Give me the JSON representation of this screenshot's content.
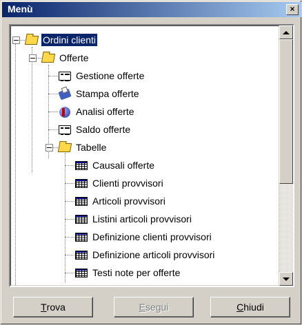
{
  "window": {
    "title": "Menù",
    "close_symbol": "×"
  },
  "tree": {
    "nodes": [
      {
        "label": "Ordini clienti",
        "icon": "folder-open-icon",
        "level": 0,
        "expanded": true,
        "selected": true
      },
      {
        "label": "Offerte",
        "icon": "folder-open-icon",
        "level": 1,
        "expanded": true
      },
      {
        "label": "Gestione offerte",
        "icon": "form-icon",
        "level": 2
      },
      {
        "label": "Stampa offerte",
        "icon": "print-icon",
        "level": 2
      },
      {
        "label": "Analisi offerte",
        "icon": "analysis-icon",
        "level": 2
      },
      {
        "label": "Saldo offerte",
        "icon": "form-icon",
        "level": 2
      },
      {
        "label": "Tabelle",
        "icon": "folder-open-icon",
        "level": 2,
        "expanded": true
      },
      {
        "label": "Causali offerte",
        "icon": "table-icon",
        "level": 3
      },
      {
        "label": "Clienti provvisori",
        "icon": "table-icon",
        "level": 3
      },
      {
        "label": "Articoli provvisori",
        "icon": "table-icon",
        "level": 3
      },
      {
        "label": "Listini articoli provvisori",
        "icon": "table-icon",
        "level": 3
      },
      {
        "label": "Definizione clienti provvisori",
        "icon": "table-icon",
        "level": 3
      },
      {
        "label": "Definizione articoli provvisori",
        "icon": "table-icon",
        "level": 3
      },
      {
        "label": "Testi note per offerte",
        "icon": "table-icon",
        "level": 3
      }
    ]
  },
  "buttons": {
    "find": {
      "mnemonic": "T",
      "rest": "rova",
      "enabled": true
    },
    "execute": {
      "mnemonic": "E",
      "rest": "segui",
      "enabled": false
    },
    "close": {
      "mnemonic": "C",
      "rest": "hiudi",
      "enabled": true
    }
  },
  "colors": {
    "titlebar_start": "#0a246a",
    "titlebar_end": "#a6caf0",
    "selection": "#0a246a",
    "face": "#d4d0c8"
  }
}
